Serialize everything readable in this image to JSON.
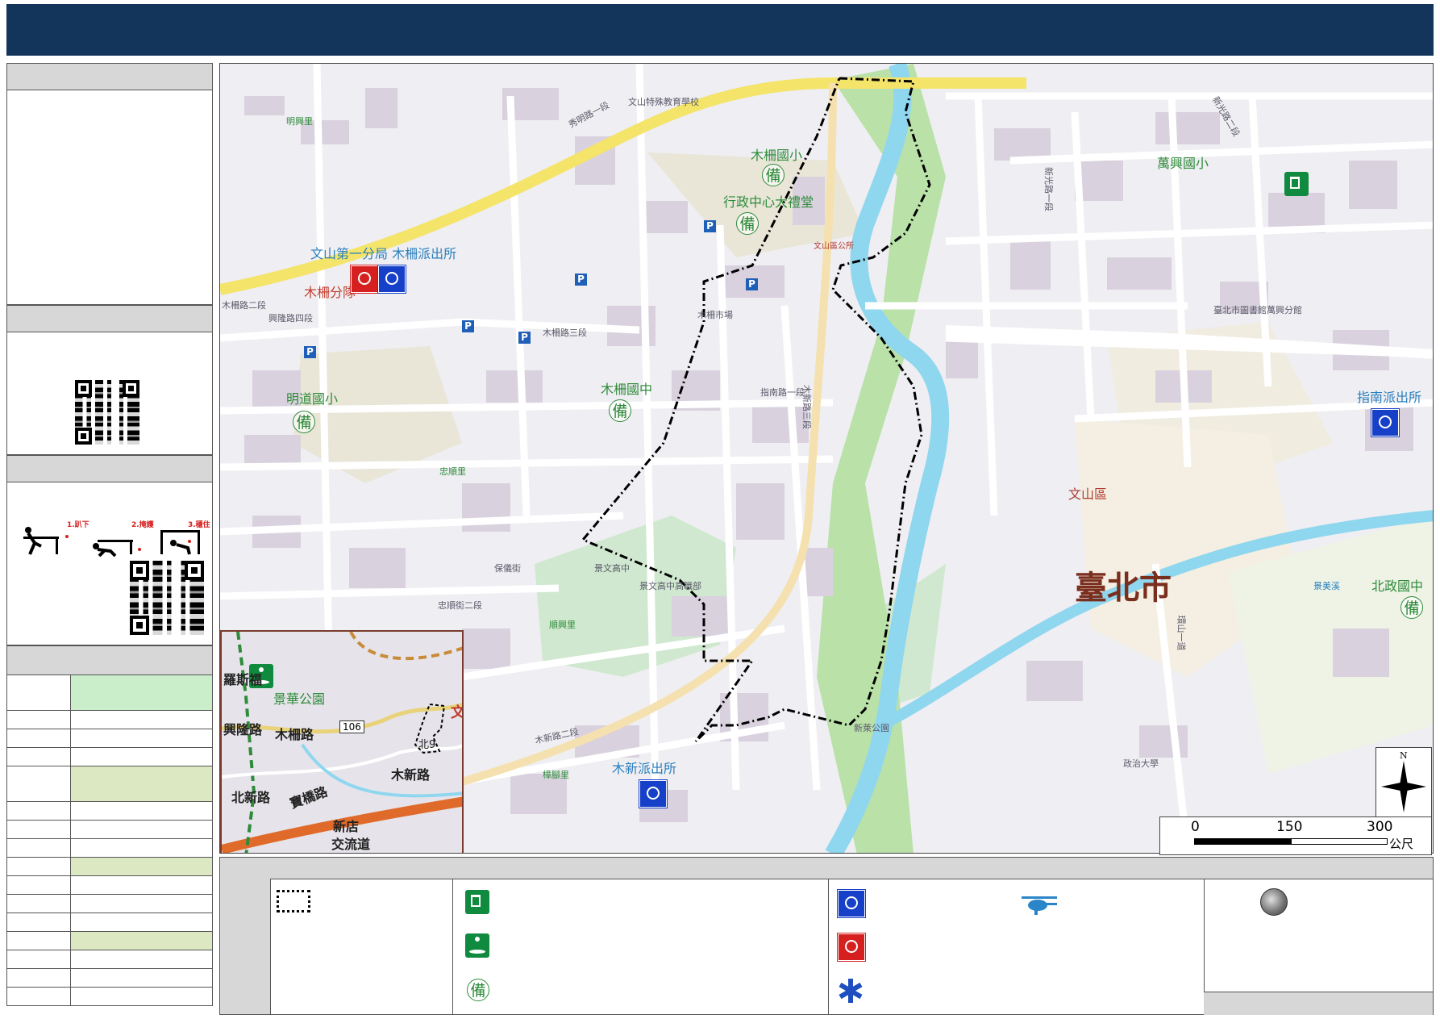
{
  "header": {
    "title": ""
  },
  "sidebar": {
    "section1_heading": "",
    "section2_heading": "",
    "section3_heading": "",
    "section4_heading": "",
    "drill_steps": [
      "1.趴下",
      "2.掩護",
      "3.穩住"
    ]
  },
  "inset_map": {
    "labels": {
      "park": "景華公園",
      "road_muzha": "木柵路",
      "road_num": "106",
      "road_xinglong": "興隆路",
      "road_beixin": "北新路",
      "road_muxin": "木新路",
      "road_baoqiao": "寶橋路",
      "road_xindian": "新店",
      "road_jiao": "交流道",
      "road_luosi": "羅斯福",
      "bei9": "北9",
      "wen": "文"
    }
  },
  "map": {
    "labels": {
      "muzha_elem": "木柵國小",
      "admin_hall": "行政中心大禮堂",
      "wanxing_elem": "萬興國小",
      "wenshan_branch": "文山第一分局 木柵派出所",
      "muzha_squad": "木柵分隊",
      "mingdao_elem": "明道國小",
      "muzha_jh": "木柵國中",
      "zhinan_police": "指南派出所",
      "wenshan_district": "文山區",
      "taipei_city": "臺北市",
      "muxin_police": "木新派出所",
      "beizheng_jh": "北政國中",
      "wenshan_ps": "文山區公所",
      "shuiming": "秀明路一段",
      "muzha_rd2": "木柵路二段",
      "muzha_rd3": "木柵路三段",
      "xinglong4": "興隆路四段",
      "muxin2": "木新路二段",
      "muxin3": "木新路三段",
      "zhinan1": "指南路一段",
      "xinguang1": "新光路一段",
      "xinguang2": "新光路二段",
      "jingmei": "景美溪",
      "huanshan": "環山一道",
      "zhengda": "政治大學",
      "jingwen_hs": "景文高中",
      "jingwen_main": "景文高中高職部",
      "mingxing": "明興里",
      "zhongshun": "忠順里",
      "shunxing": "順興里",
      "zhangzhi": "樟腳里",
      "wenshan_special": "文山特殊教育學校",
      "muxin_park": "新萊公園",
      "baoyi": "保儀街",
      "zhongshun2": "忠順街二段",
      "muzha_market": "木柵市場",
      "wanxing_library": "臺北市圖書館萬興分館"
    }
  },
  "scale": {
    "ticks": [
      "0",
      "150",
      "300"
    ],
    "unit": "公尺"
  },
  "north": {
    "label": "N"
  },
  "legend": {
    "headings": [
      "",
      "",
      "",
      "",
      ""
    ],
    "bei_glyph": "備"
  },
  "colors": {
    "header": "#13345b",
    "police": "#1740c8",
    "fire": "#d62020",
    "shelter": "#0f8a3e",
    "boundary": "#000000",
    "river": "#8fd6ef",
    "green_cell": "#c9eec9",
    "olive_cell": "#dce8c2"
  }
}
